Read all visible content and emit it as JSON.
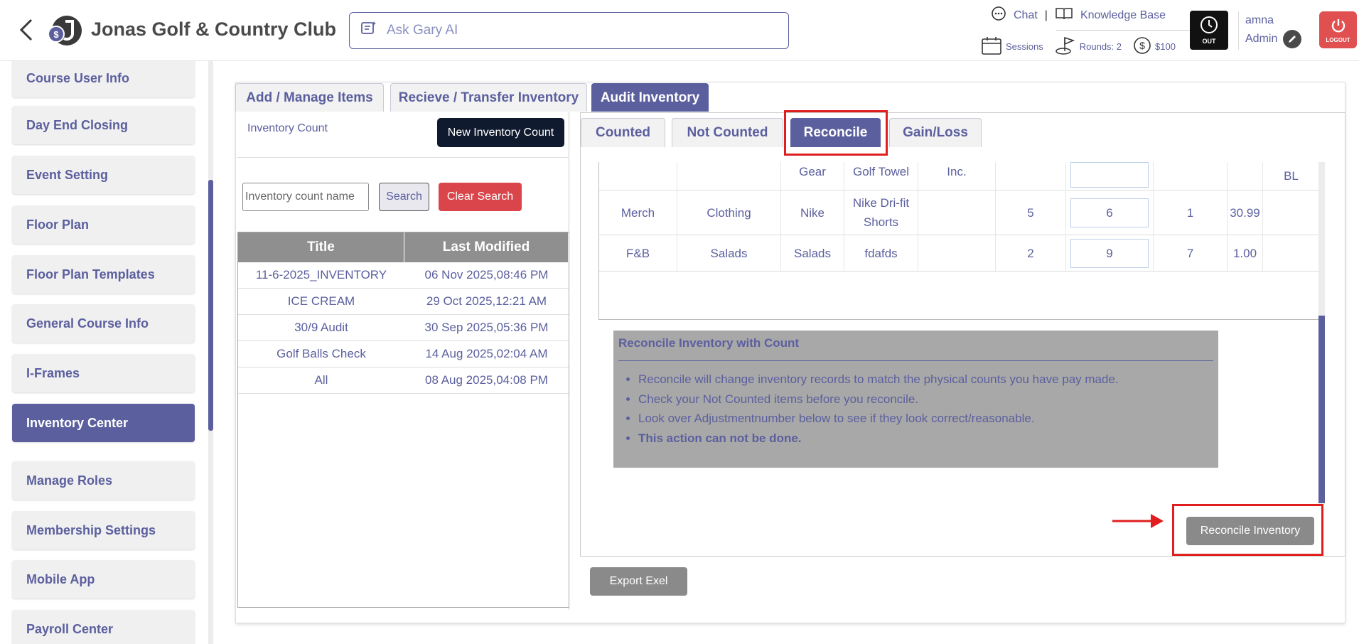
{
  "header": {
    "club_name": "Jonas Golf & Country Club",
    "ask_placeholder": "Ask Gary AI",
    "chat": "Chat",
    "separator": "|",
    "knowledge_base": "Knowledge Base",
    "sessions": "Sessions",
    "rounds": "Rounds: 2",
    "amount": "$100",
    "out_label": "OUT",
    "user_name": "amna",
    "user_role": "Admin",
    "logout_label": "LOGOUT"
  },
  "sidebar": {
    "items": [
      {
        "label": "Course User Info"
      },
      {
        "label": "Day End Closing"
      },
      {
        "label": "Event Setting"
      },
      {
        "label": "Floor Plan"
      },
      {
        "label": "Floor Plan Templates"
      },
      {
        "label": "General Course Info"
      },
      {
        "label": "I-Frames"
      },
      {
        "label": "Inventory Center"
      },
      {
        "label": "Manage Roles"
      },
      {
        "label": "Membership Settings"
      },
      {
        "label": "Mobile App"
      },
      {
        "label": "Payroll Center"
      }
    ],
    "active_index": 7
  },
  "main_tabs": [
    "Add / Manage Items",
    "Recieve / Transfer Inventory",
    "Audit Inventory"
  ],
  "inventory": {
    "count_label": "Inventory Count",
    "new_count_button": "New Inventory Count",
    "search_placeholder": "Inventory count name",
    "search_button": "Search",
    "clear_button": "Clear Search",
    "headers": [
      "Title",
      "Last Modified"
    ],
    "rows": [
      [
        "11-6-2025_INVENTORY",
        "06 Nov 2025,08:46 PM"
      ],
      [
        "ICE CREAM",
        "29 Oct 2025,12:21 AM"
      ],
      [
        "30/9 Audit",
        "30 Sep 2025,05:36 PM"
      ],
      [
        "Golf Balls Check",
        "14 Aug 2025,02:04 AM"
      ],
      [
        "All",
        "08 Aug 2025,04:08 PM"
      ]
    ]
  },
  "sub_tabs": [
    "Counted",
    "Not Counted",
    "Reconcile",
    "Gain/Loss"
  ],
  "detail_table": {
    "partial_row": [
      "",
      "",
      "Gear",
      "Golf Towel",
      "Inc.",
      "",
      "",
      "",
      "",
      "BL"
    ],
    "rows": [
      [
        "Merch",
        "Clothing",
        "Nike",
        "Nike Dri-fit Shorts",
        "",
        "5",
        "6",
        "1",
        "30.99",
        ""
      ],
      [
        "F&B",
        "Salads",
        "Salads",
        "fdafds",
        "",
        "2",
        "9",
        "7",
        "1.00",
        ""
      ]
    ]
  },
  "reconcile_info": {
    "title": "Reconcile Inventory with Count",
    "bullets": [
      "Reconcile will change inventory records to match the physical counts you have pay made.",
      "Check your Not Counted items before you reconcile.",
      "Look over Adjustmentnumber below to see if they look correct/reasonable."
    ],
    "warning": "This action can not be done."
  },
  "buttons": {
    "reconcile": "Reconcile Inventory",
    "export": "Export Exel"
  },
  "colors": {
    "accent": "#5b5f9e",
    "highlight": "#e01e1e",
    "danger": "#d9454a"
  }
}
